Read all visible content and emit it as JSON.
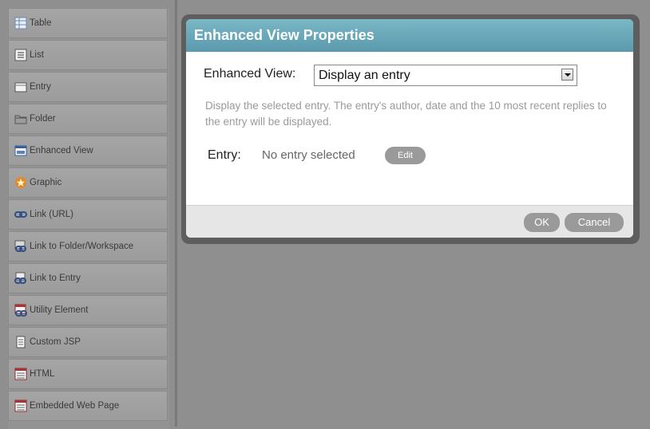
{
  "palette": {
    "items": [
      {
        "label": "Table",
        "icon": "table-icon"
      },
      {
        "label": "List",
        "icon": "list-icon"
      },
      {
        "label": "Entry",
        "icon": "entry-icon"
      },
      {
        "label": "Folder",
        "icon": "folder-icon"
      },
      {
        "label": "Enhanced View",
        "icon": "enhanced-view-icon"
      },
      {
        "label": "Graphic",
        "icon": "graphic-icon"
      },
      {
        "label": "Link (URL)",
        "icon": "link-icon"
      },
      {
        "label": "Link to Folder/Workspace",
        "icon": "link-folder-icon"
      },
      {
        "label": "Link to Entry",
        "icon": "link-entry-icon"
      },
      {
        "label": "Utility Element",
        "icon": "utility-element-icon"
      },
      {
        "label": "Custom JSP",
        "icon": "custom-jsp-icon"
      },
      {
        "label": "HTML",
        "icon": "html-icon"
      },
      {
        "label": "Embedded Web Page",
        "icon": "embedded-web-page-icon"
      }
    ]
  },
  "dialog": {
    "title": "Enhanced View Properties",
    "enhanced_view_label": "Enhanced View:",
    "enhanced_view_value": "Display an entry",
    "description": "Display the selected entry. The entry's author, date and the 10 most recent replies to the entry will be displayed.",
    "entry_label": "Entry:",
    "entry_value": "No entry selected",
    "edit_label": "Edit",
    "ok_label": "OK",
    "cancel_label": "Cancel"
  },
  "colors": {
    "header": "#6aa8b9",
    "background": "#8f8f8f",
    "pill_button": "#9a9a9a"
  }
}
